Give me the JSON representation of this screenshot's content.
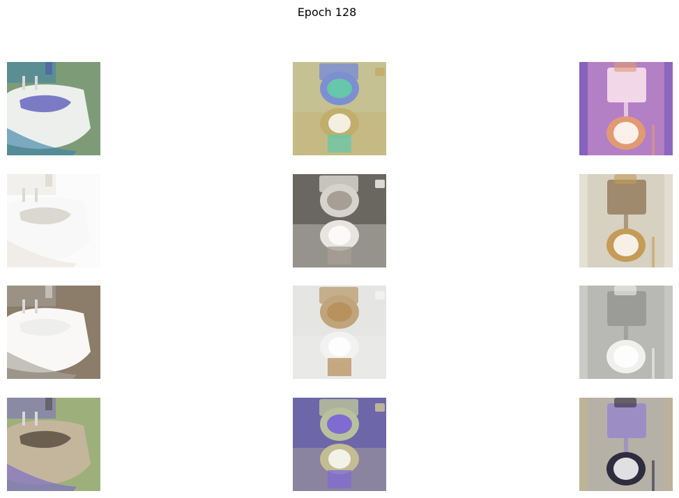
{
  "figure": {
    "title": "Epoch 128"
  },
  "images": [
    {
      "row": 1,
      "col": 1,
      "name": "sample-image-r1c1",
      "bg": "#7e9b78",
      "accent": "#4a4ab4",
      "tint": "#3d83a8",
      "paper": "#f3f3f3",
      "style": "seat-cover"
    },
    {
      "row": 1,
      "col": 2,
      "name": "sample-image-r1c2",
      "bg": "#c6c193",
      "accent": "#7c8fd1",
      "tint": "#66c7aa",
      "paper": "#c2ae6b",
      "style": "toilet-front"
    },
    {
      "row": 1,
      "col": 3,
      "name": "sample-image-r1c3",
      "bg": "#b37fc5",
      "accent": "#e19a73",
      "tint": "#f1d7e7",
      "paper": "#5e4ab7",
      "style": "toilet-tank"
    },
    {
      "row": 2,
      "col": 1,
      "name": "sample-image-r2c1",
      "bg": "#fbfbfb",
      "accent": "#cfcac1",
      "tint": "#ebe7e0",
      "paper": "#f8f8f8",
      "style": "seat-cover"
    },
    {
      "row": 2,
      "col": 2,
      "name": "sample-image-r2c2",
      "bg": "#6a6660",
      "accent": "#d6d3cd",
      "tint": "#a79f95",
      "paper": "#e8e5e0",
      "style": "toilet-front"
    },
    {
      "row": 2,
      "col": 3,
      "name": "sample-image-r2c3",
      "bg": "#d7d1c2",
      "accent": "#c59b57",
      "tint": "#a08a6d",
      "paper": "#f0ece4",
      "style": "toilet-tank"
    },
    {
      "row": 3,
      "col": 1,
      "name": "sample-image-r3c1",
      "bg": "#8c7c6a",
      "accent": "#e9e9e7",
      "tint": "#a7a29a",
      "paper": "#ffffff",
      "style": "seat-cover"
    },
    {
      "row": 3,
      "col": 2,
      "name": "sample-image-r3c2",
      "bg": "#e5e5e3",
      "accent": "#c0a47b",
      "tint": "#b7925e",
      "paper": "#f2f2f2",
      "style": "toilet-front"
    },
    {
      "row": 3,
      "col": 3,
      "name": "sample-image-r3c3",
      "bg": "#b8b8b5",
      "accent": "#f0f0ee",
      "tint": "#9b9b98",
      "paper": "#d8d8d6",
      "style": "toilet-tank"
    },
    {
      "row": 4,
      "col": 1,
      "name": "sample-image-r4c1",
      "bg": "#9db07b",
      "accent": "#463a32",
      "tint": "#7a6cc7",
      "paper": "#c6b69f",
      "style": "seat-cover"
    },
    {
      "row": 4,
      "col": 2,
      "name": "sample-image-r4c2",
      "bg": "#6d66a8",
      "accent": "#b9c09d",
      "tint": "#7f6bd1",
      "paper": "#c4bc93",
      "style": "toilet-front"
    },
    {
      "row": 4,
      "col": 3,
      "name": "sample-image-r4c3",
      "bg": "#b6b1a6",
      "accent": "#2f2c3e",
      "tint": "#9c8ec4",
      "paper": "#c3b48a",
      "style": "toilet-tank"
    }
  ]
}
